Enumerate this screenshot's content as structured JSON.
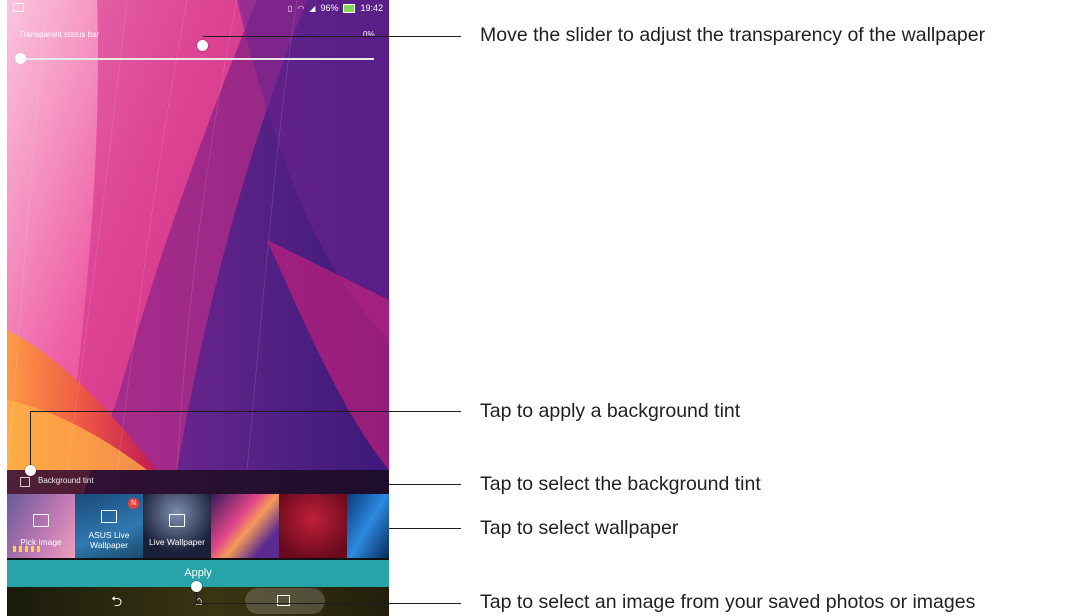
{
  "status_bar": {
    "battery_percent": "96%",
    "time": "19:42",
    "icons": [
      "vibrate-icon",
      "wifi-icon",
      "signal-icon",
      "battery-charging-icon"
    ],
    "battery_color": "#7ed957"
  },
  "settings": {
    "transparent_status_bar_label": "Transparent status bar",
    "transparency_value": "0%",
    "background_tint_label": "Background tint",
    "background_tint_checked": false
  },
  "thumbnails": [
    {
      "label": "Pick image",
      "icon": "gallery-icon"
    },
    {
      "label": "ASUS Live Wallpaper",
      "icon": "gallery-icon",
      "badge": "N"
    },
    {
      "label": "Live Wallpaper",
      "icon": "gallery-icon"
    },
    {
      "label": "",
      "icon": ""
    },
    {
      "label": "",
      "icon": ""
    },
    {
      "label": "",
      "icon": ""
    }
  ],
  "apply_label": "Apply",
  "nav": {
    "back_icon": "back-icon",
    "home_icon": "home-icon",
    "recents_icon": "recents-icon"
  },
  "callouts": {
    "slider": "Move the slider to adjust the transparency of the wallpaper",
    "tint_apply": "Tap to apply a background tint",
    "tint_select": "Tap to select the background tint",
    "wallpaper": "Tap to select wallpaper",
    "image": "Tap to select an image from your saved photos or images"
  },
  "colors": {
    "apply_bar": "#26a4a8",
    "badge": "#e8413a"
  }
}
